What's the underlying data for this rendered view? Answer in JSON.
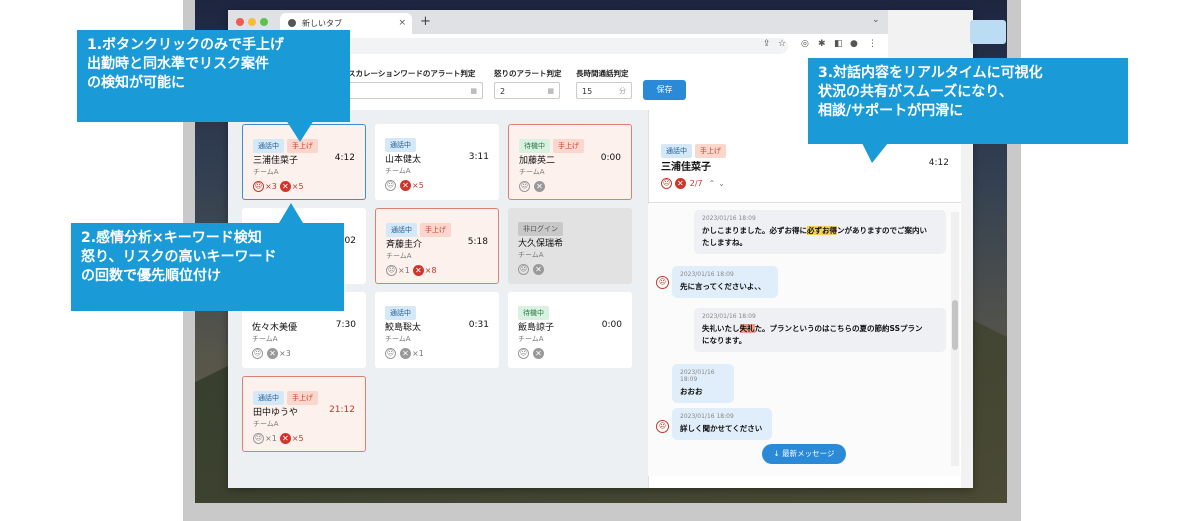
{
  "browser": {
    "tab_title": "新しいタブ",
    "tab_close": "×",
    "new_tab": "+",
    "menu_chevron": "⌄"
  },
  "settings": {
    "escalation_label": "スカレーションワードのアラート判定",
    "anger_label": "怒りのアラート判定",
    "anger_value": "2",
    "long_call_label": "長時間通話判定",
    "long_call_value": "15",
    "long_call_unit": "分",
    "save_label": "保存"
  },
  "badges": {
    "call": "通話中",
    "hand": "手上げ",
    "wait": "待機中",
    "offline": "非ログイン"
  },
  "cards": [
    {
      "name": "三浦佳菜子",
      "time": "4:12",
      "team": "チームA",
      "sad_count": "×3",
      "x_count": "×5"
    },
    {
      "name": "山本健太",
      "time": "3:11",
      "team": "チームA",
      "x_count": "×5"
    },
    {
      "name": "加藤英二",
      "time": "0:00",
      "team": "チームA"
    },
    {
      "time": "02"
    },
    {
      "name": "斉藤圭介",
      "time": "5:18",
      "team": "チームA",
      "sad_count": "×1",
      "x_count": "×8"
    },
    {
      "name": "大久保瑞希",
      "team": "チームA"
    },
    {
      "name": "佐々木美優",
      "time": "7:30",
      "team": "チームA",
      "x_count": "×3"
    },
    {
      "name": "鮫島聡太",
      "time": "0:31",
      "team": "チームA",
      "x_count": "×1"
    },
    {
      "name": "飯島諒子",
      "time": "0:00",
      "team": "チームA"
    },
    {
      "name": "田中ゆうや",
      "time": "21:12",
      "team": "チームA",
      "sad_count": "×1",
      "x_count": "×5"
    }
  ],
  "panel": {
    "name": "三浦佳菜子",
    "time": "4:12",
    "count": "2/7",
    "up": "⌃",
    "down": "⌄"
  },
  "chat": {
    "messages": [
      {
        "ts": "2023/01/16 18:09",
        "pre": "かしこまりました。必ずお得に",
        "hl": "必ずお得",
        "post": "ンがありますのでご案内い",
        "line2": "たしますね。"
      },
      {
        "ts": "2023/01/16 18:09",
        "text": "先に言ってくださいよ、、"
      },
      {
        "ts": "2023/01/16 18:09",
        "pre": "失礼いたし",
        "hl": "失礼",
        "post": "た。プランというのはこちらの夏の節約SSプラン",
        "line2": "になります。"
      },
      {
        "ts": "2023/01/16 18:09",
        "text": "おおお"
      },
      {
        "ts": "2023/01/16 18:09",
        "text": "詳しく聞かせてください"
      }
    ],
    "latest_button": "最新メッセージ"
  },
  "callouts": [
    {
      "text": "1.ボタンクリックのみで手上げ\n出勤時と同水準でリスク案件\nの検知が可能に"
    },
    {
      "text": "2.感情分析×キーワード検知\n怒り、リスクの高いキーワード\nの回数で優先順位付け"
    },
    {
      "text": "3.対話内容をリアルタイムに可視化\n状況の共有がスムーズになり、\n相談/サポートが円滑に"
    }
  ],
  "colors": {
    "accent": "#1a9ad6",
    "button": "#2a8ad8",
    "alert_border": "#d9826f",
    "danger": "#d0352a"
  }
}
